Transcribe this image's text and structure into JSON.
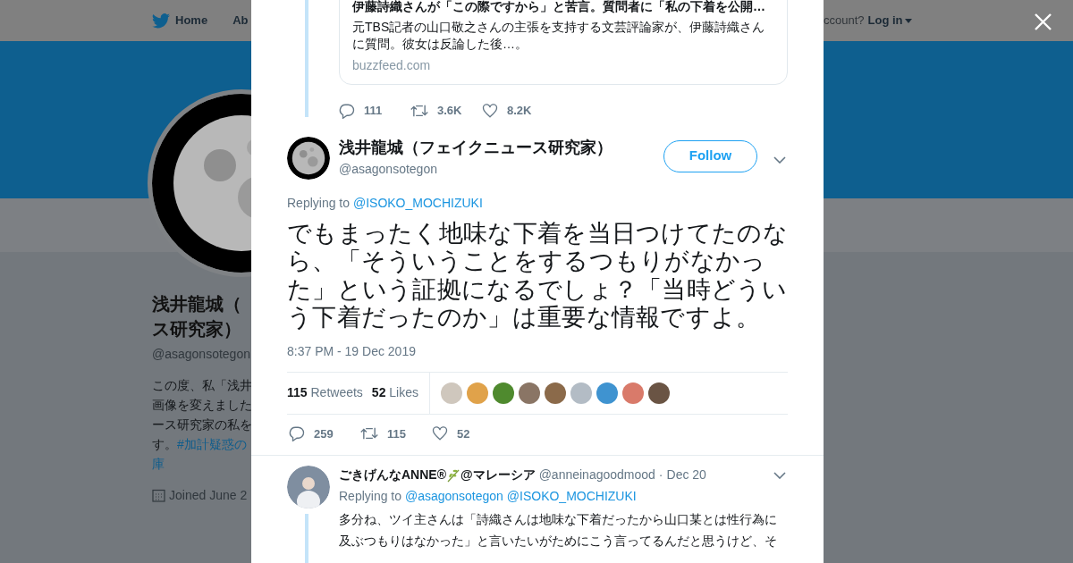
{
  "nav": {
    "items": [
      {
        "kind": "home",
        "label": "Home"
      },
      {
        "kind": "plain",
        "label": "Ab"
      }
    ],
    "account_prompt": "ccount?",
    "login": "Log in"
  },
  "profile": {
    "name_lines": [
      "浅井龍城（",
      "ス研究家）"
    ],
    "handle": "@asagonsotegon",
    "bio_lines": [
      {
        "text": "この度、私「浅井"
      },
      {
        "text": "画像を変えました"
      },
      {
        "text": "ース研究家の私を"
      },
      {
        "text": "す。",
        "link": "#加計疑惑の"
      },
      {
        "link": "庫"
      }
    ],
    "joined": "Joined June 2"
  },
  "thread": {
    "card": {
      "title": "伊藤詩織さんが「この際ですから」と苦言。質問者に「私の下着を公開…",
      "description": "元TBS記者の山口敬之さんの主張を支持する文芸評論家が、伊藤詩織さんに質問。彼女は反論した後…。",
      "domain": "buzzfeed.com"
    },
    "actions": [
      {
        "kind": "reply",
        "count": "111"
      },
      {
        "kind": "retweet",
        "count": "3.6K"
      },
      {
        "kind": "like",
        "count": "8.2K"
      }
    ]
  },
  "tweet": {
    "name": "浅井龍城（フェイクニュース研究家）",
    "handle": "@asagonsotegon",
    "follow": "Follow",
    "replying_label": "Replying to",
    "replying_to": [
      "@ISOKO_MOCHIZUKI"
    ],
    "text": "でもまったく地味な下着を当日つけてたのなら、「そういうことをするつもりがなかった」という証拠になるでしょ？「当時どういう下着だったのか」は重要な情報ですよ。",
    "time": "8:37 PM - 19 Dec 2019",
    "stats": [
      {
        "count": "115",
        "label": "Retweets"
      },
      {
        "count": "52",
        "label": "Likes"
      }
    ],
    "likers": [
      {
        "color": "#cfc7bd"
      },
      {
        "color": "#e0a24a"
      },
      {
        "color": "#4f8a2e"
      },
      {
        "color": "#8a7565"
      },
      {
        "color": "#8b6a4a"
      },
      {
        "color": "#b3bcc5"
      },
      {
        "color": "#3f93d0"
      },
      {
        "color": "#d97a6a"
      },
      {
        "color": "#6a5444"
      }
    ],
    "actions": [
      {
        "kind": "reply",
        "count": "259"
      },
      {
        "kind": "retweet",
        "count": "115"
      },
      {
        "kind": "like",
        "count": "52"
      }
    ]
  },
  "reply": {
    "name_before": "ごきげんなANNE®",
    "name_after": "@マレーシア",
    "handle": "@anneinagoodmood",
    "separator": "·",
    "date": "Dec 20",
    "replying_label": "Replying to",
    "replying_to": [
      "@asagonsotegon",
      "@ISOKO_MOCHIZUKI"
    ],
    "text": "多分ね、ツイ主さんは「詩織さんは地味な下着だったから山口某とは性行為に及ぶつもりはなかった」と言いたいがためにこう言ってるんだと思うけど、そ"
  }
}
